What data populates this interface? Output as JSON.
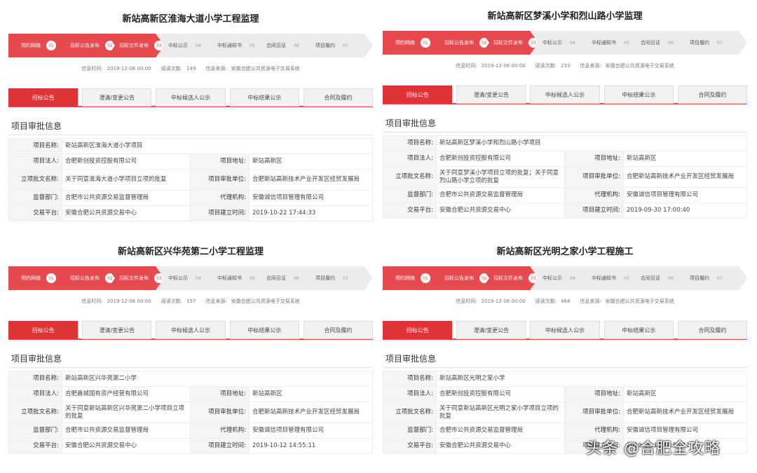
{
  "panels": [
    {
      "title": "新站高新区淮海大道小学工程监理",
      "steps": [
        {
          "label": "预约网络",
          "num": "01",
          "active": true
        },
        {
          "label": "招标公告发布",
          "num": "02",
          "active": true
        },
        {
          "label": "招标文件发布",
          "num": "03",
          "active": true
        },
        {
          "label": "中标公示",
          "num": "04",
          "active": false
        },
        {
          "label": "中标通知书",
          "num": "05",
          "active": false
        },
        {
          "label": "合同见证",
          "num": "06",
          "active": false
        },
        {
          "label": "项目履约",
          "num": "07",
          "active": false
        }
      ],
      "info": {
        "time_label": "信息时间:",
        "time": "2019-12-06 00:00",
        "views_label": "阅读次数:",
        "views": "149",
        "source_label": "信息来源:",
        "source": "安徽合肥公共资源电子交易系统"
      },
      "tabs": [
        "招标公告",
        "澄清/变更公告",
        "中标候选人公示",
        "中标结果公示",
        "合同及履约"
      ],
      "section": "项目审批信息",
      "fields": {
        "name_k": "项目名称:",
        "name": "新站高新区淮海大道小学项目",
        "legal_k": "项目法人:",
        "legal": "合肥新创投资控股有限公司",
        "addr_k": "项目地址:",
        "addr": "新站高新区",
        "doc_k": "立项批文名称:",
        "doc": "关于同意淮海大道小学项目立项的批复",
        "unit_k": "项目审批单位:",
        "unit": "合肥新站高新技术产业开发区经贸发展局",
        "sup_k": "监督部门:",
        "sup": "合肥市公共资源交易监督管理局",
        "agent_k": "代理机构:",
        "agent": "安徽诚信项目管理有限公司",
        "plat_k": "交易平台:",
        "plat": "安徽合肥公共资源交易中心",
        "date_k": "项目建立时间:",
        "date": "2019-10-22 17:44:33"
      }
    },
    {
      "title": "新站高新区梦溪小学和烈山路小学监理",
      "steps": [
        {
          "label": "预约网络",
          "num": "01",
          "active": true
        },
        {
          "label": "招标公告发布",
          "num": "02",
          "active": true
        },
        {
          "label": "招标文件发布",
          "num": "03",
          "active": true
        },
        {
          "label": "中标公示",
          "num": "04",
          "active": false
        },
        {
          "label": "中标通知书",
          "num": "05",
          "active": false
        },
        {
          "label": "合同见证",
          "num": "06",
          "active": false
        },
        {
          "label": "项目履约",
          "num": "07",
          "active": false
        }
      ],
      "info": {
        "time_label": "信息时间:",
        "time": "2019-12-06 00:00",
        "views_label": "阅读次数:",
        "views": "233",
        "source_label": "信息来源:",
        "source": "安徽合肥公共资源电子交易系统"
      },
      "tabs": [
        "招标公告",
        "澄清/变更公告",
        "中标候选人公示",
        "中标结果公示",
        "合同及履约"
      ],
      "section": "项目审批信息",
      "fields": {
        "name_k": "项目名称:",
        "name": "新站高新区梦溪小学和烈山路小学项目",
        "legal_k": "项目法人:",
        "legal": "合肥新创投资控股有限公司",
        "addr_k": "项目地址:",
        "addr": "新站高新区",
        "doc_k": "立项批文名称:",
        "doc": "关于同意梦溪小学项目立项的批复；关于同意烈山路小学立项的批复",
        "unit_k": "项目审批单位:",
        "unit": "合肥新站高新技术产业开发区经贸发展局",
        "sup_k": "监督部门:",
        "sup": "合肥市公共资源交易监督管理局",
        "agent_k": "代理机构:",
        "agent": "安徽诚信项目管理有限公司",
        "plat_k": "交易平台:",
        "plat": "安徽合肥公共资源交易中心",
        "date_k": "项目建立时间:",
        "date": "2019-09-30 17:00:40"
      }
    },
    {
      "title": "新站高新区兴华苑第二小学工程监理",
      "steps": [
        {
          "label": "预约网络",
          "num": "01",
          "active": true
        },
        {
          "label": "招标公告发布",
          "num": "02",
          "active": true
        },
        {
          "label": "招标文件发布",
          "num": "03",
          "active": true
        },
        {
          "label": "中标公示",
          "num": "04",
          "active": false
        },
        {
          "label": "中标通知书",
          "num": "05",
          "active": false
        },
        {
          "label": "合同见证",
          "num": "06",
          "active": false
        },
        {
          "label": "项目履约",
          "num": "07",
          "active": false
        }
      ],
      "info": {
        "time_label": "信息时间:",
        "time": "2019-12-06 00:00",
        "views_label": "阅读次数:",
        "views": "157",
        "source_label": "信息来源:",
        "source": "安徽合肥公共资源电子交易系统"
      },
      "tabs": [
        "招标公告",
        "澄清/变更公告",
        "中标候选人公示",
        "中标结果公示",
        "合同及履约"
      ],
      "section": "项目审批信息",
      "fields": {
        "name_k": "项目名称:",
        "name": "新站高新区兴华苑第二小学",
        "legal_k": "项目法人:",
        "legal": "合肥鑫城国有资产经营有限公司",
        "addr_k": "项目地址:",
        "addr": "新站高新区",
        "doc_k": "立项批文名称:",
        "doc": "关于同意新站高新区兴华苑第二小学项目立项的批复",
        "unit_k": "项目审批单位:",
        "unit": "合肥新站高新技术产业开发区经贸发展局",
        "sup_k": "监督部门:",
        "sup": "合肥市公共资源交易监督管理局",
        "agent_k": "代理机构:",
        "agent": "安徽诚信项目管理有限公司",
        "plat_k": "交易平台:",
        "plat": "安徽合肥公共资源交易中心",
        "date_k": "项目建立时间:",
        "date": "2019-10-12 14:55:11"
      }
    },
    {
      "title": "新站高新区光明之家小学工程施工",
      "steps": [
        {
          "label": "预约网络",
          "num": "01",
          "active": true
        },
        {
          "label": "招标公告发布",
          "num": "02",
          "active": true
        },
        {
          "label": "招标文件发布",
          "num": "03",
          "active": true
        },
        {
          "label": "中标公示",
          "num": "04",
          "active": false
        },
        {
          "label": "中标通知书",
          "num": "05",
          "active": false
        },
        {
          "label": "合同见证",
          "num": "06",
          "active": false
        },
        {
          "label": "项目履约",
          "num": "07",
          "active": false
        }
      ],
      "info": {
        "time_label": "信息时间:",
        "time": "2019-12-06 00:00",
        "views_label": "阅读次数:",
        "views": "468",
        "source_label": "信息来源:",
        "source": "安徽合肥公共资源电子交易系统"
      },
      "tabs": [
        "招标公告",
        "澄清/变更公告",
        "中标候选人公示",
        "中标结果公示",
        "合同及履约"
      ],
      "section": "项目审批信息",
      "fields": {
        "name_k": "项目名称:",
        "name": "新站高新区光明之家小学",
        "legal_k": "项目法人:",
        "legal": "合肥新创投资控股有限公司",
        "addr_k": "项目地址:",
        "addr": "新站高新区",
        "doc_k": "立项批文名称:",
        "doc": "关于同意新站高新区光明之家小学项目立项的批复",
        "unit_k": "项目审批单位:",
        "unit": "合肥新站高新技术产业开发区经贸发展局",
        "sup_k": "监督部门:",
        "sup": "合肥市公共资源交易监督管理局",
        "agent_k": "代理机构:",
        "agent": "安徽诚信项目管理有限公司",
        "plat_k": "交易平台:",
        "plat": "安徽合肥公共资源交易中心",
        "date_k": "项目建立时间:",
        "date": "2019-10-12 14:55:11"
      }
    }
  ],
  "watermark": "头条 @合肥全攻略",
  "colors": {
    "accent": "#e64a4f",
    "tab_active": "#e03338"
  }
}
